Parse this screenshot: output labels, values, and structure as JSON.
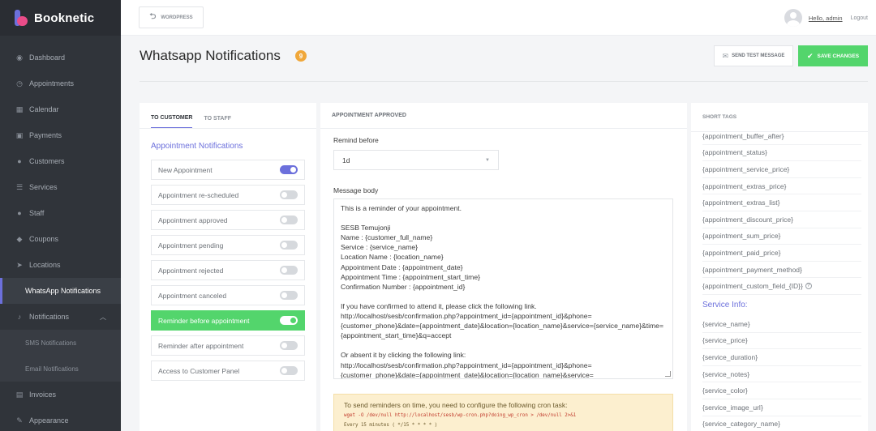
{
  "app": {
    "name": "Booknetic"
  },
  "sidebar": {
    "items": [
      {
        "label": "Dashboard",
        "icon": "dashboard-icon"
      },
      {
        "label": "Appointments",
        "icon": "clock-icon"
      },
      {
        "label": "Calendar",
        "icon": "calendar-icon"
      },
      {
        "label": "Payments",
        "icon": "wallet-icon"
      },
      {
        "label": "Customers",
        "icon": "users-icon"
      },
      {
        "label": "Services",
        "icon": "list-icon"
      },
      {
        "label": "Staff",
        "icon": "user-icon"
      },
      {
        "label": "Coupons",
        "icon": "tag-icon"
      },
      {
        "label": "Locations",
        "icon": "location-icon"
      },
      {
        "label": "WhatsApp Notifications",
        "icon": ""
      },
      {
        "label": "Notifications",
        "icon": "bell-icon"
      },
      {
        "label": "SMS Notifications",
        "icon": ""
      },
      {
        "label": "Email Notifications",
        "icon": ""
      },
      {
        "label": "Invoices",
        "icon": "file-icon"
      },
      {
        "label": "Appearance",
        "icon": "brush-icon"
      }
    ]
  },
  "topbar": {
    "wp_label": "WORDPRESS",
    "hello": "Hello, admin",
    "logout": "Logout"
  },
  "header": {
    "title": "Whatsapp Notifications",
    "count": "9",
    "test_label": "SEND TEST MESSAGE",
    "save_label": "SAVE CHANGES"
  },
  "colors": {
    "accent": "#6c70dc",
    "success": "#53d56c",
    "sidebar": "#30343a",
    "badge": "#f0a73a"
  },
  "left": {
    "tabs": [
      "TO CUSTOMER",
      "TO STAFF"
    ],
    "section": "Appointment Notifications",
    "items": [
      {
        "label": "New Appointment",
        "on": true
      },
      {
        "label": "Appointment re-scheduled",
        "on": false
      },
      {
        "label": "Appointment approved",
        "on": false
      },
      {
        "label": "Appointment pending",
        "on": false
      },
      {
        "label": "Appointment rejected",
        "on": false
      },
      {
        "label": "Appointment canceled",
        "on": false
      },
      {
        "label": "Reminder before appointment",
        "on": true
      },
      {
        "label": "Reminder after appointment",
        "on": false
      },
      {
        "label": "Access to Customer Panel",
        "on": false
      }
    ]
  },
  "mid": {
    "header": "APPOINTMENT APPROVED",
    "remind_label": "Remind before",
    "remind_value": "1d",
    "body_label": "Message body",
    "body": "This is a reminder of your appointment.\n\nSESB Temujonji\nName : {customer_full_name}\nService : {service_name}\nLocation Name : {location_name}\nAppointment Date : {appointment_date}\nAppointment Time : {appointment_start_time}\nConfirmation Number : {appointment_id}\n\nIf you have confirmed to attend it, please click the following link.\nhttp://localhost/sesb/confirmation.php?appointment_id={appointment_id}&phone={customer_phone}&date={appointment_date}&location={location_name}&service={service_name}&time={appointment_start_time}&q=accept\n\nOr absent it by clicking the following link:\nhttp://localhost/sesb/confirmation.php?appointment_id={appointment_id}&phone={customer_phone}&date={appointment_date}&location={location_name}&service=",
    "cron_text": "To send reminders on time, you need to configure the following cron task:",
    "cron_cmd": "wget -O /dev/null http://localhost/sesb/wp-cron.php?doing_wp_cron > /dev/null 2>&1",
    "cron_hint": "Every 15 minutes ( */15 * * * * )"
  },
  "right": {
    "header": "SHORT TAGS",
    "tags": [
      "{appointment_buffer_after}",
      "{appointment_status}",
      "{appointment_service_price}",
      "{appointment_extras_price}",
      "{appointment_extras_list}",
      "{appointment_discount_price}",
      "{appointment_sum_price}",
      "{appointment_paid_price}",
      "{appointment_payment_method}",
      "{appointment_custom_field_{ID}}"
    ],
    "service_title": "Service Info:",
    "service_tags": [
      "{service_name}",
      "{service_price}",
      "{service_duration}",
      "{service_notes}",
      "{service_color}",
      "{service_image_url}",
      "{service_category_name}"
    ]
  }
}
